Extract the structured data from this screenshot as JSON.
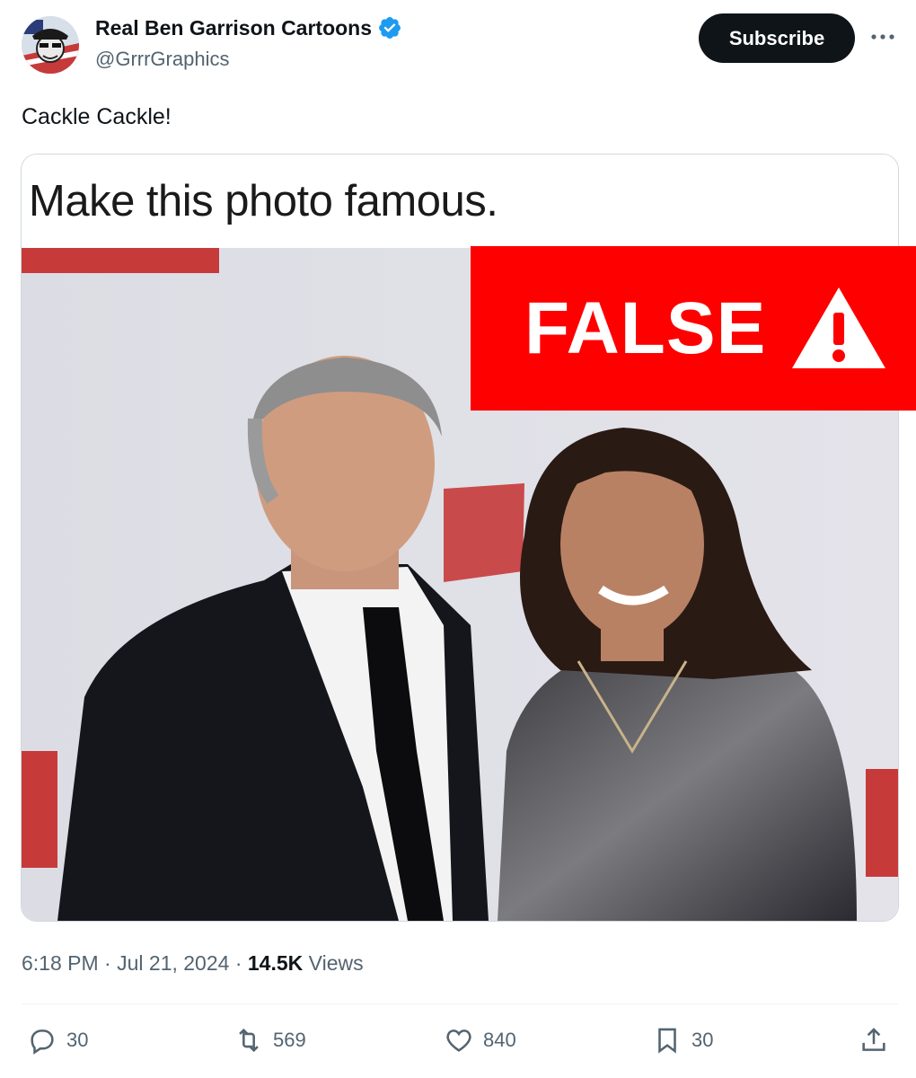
{
  "author": {
    "display_name": "Real Ben Garrison Cartoons",
    "handle": "@GrrrGraphics",
    "verified_icon": "verified-badge-icon"
  },
  "buttons": {
    "subscribe_label": "Subscribe"
  },
  "tweet": {
    "text": "Cackle Cackle!"
  },
  "media": {
    "caption": "Make this photo famous.",
    "false_label": "FALSE",
    "warning_icon": "warning-triangle-icon"
  },
  "meta": {
    "time": "6:18 PM",
    "date": "Jul 21, 2024",
    "views_count": "14.5K",
    "views_label": "Views"
  },
  "actions": {
    "replies": "30",
    "reposts": "569",
    "likes": "840",
    "bookmarks": "30"
  },
  "colors": {
    "accent_dark": "#0f1419",
    "muted": "#536471",
    "verified_blue": "#1d9bf0",
    "false_red": "#ff0000"
  }
}
